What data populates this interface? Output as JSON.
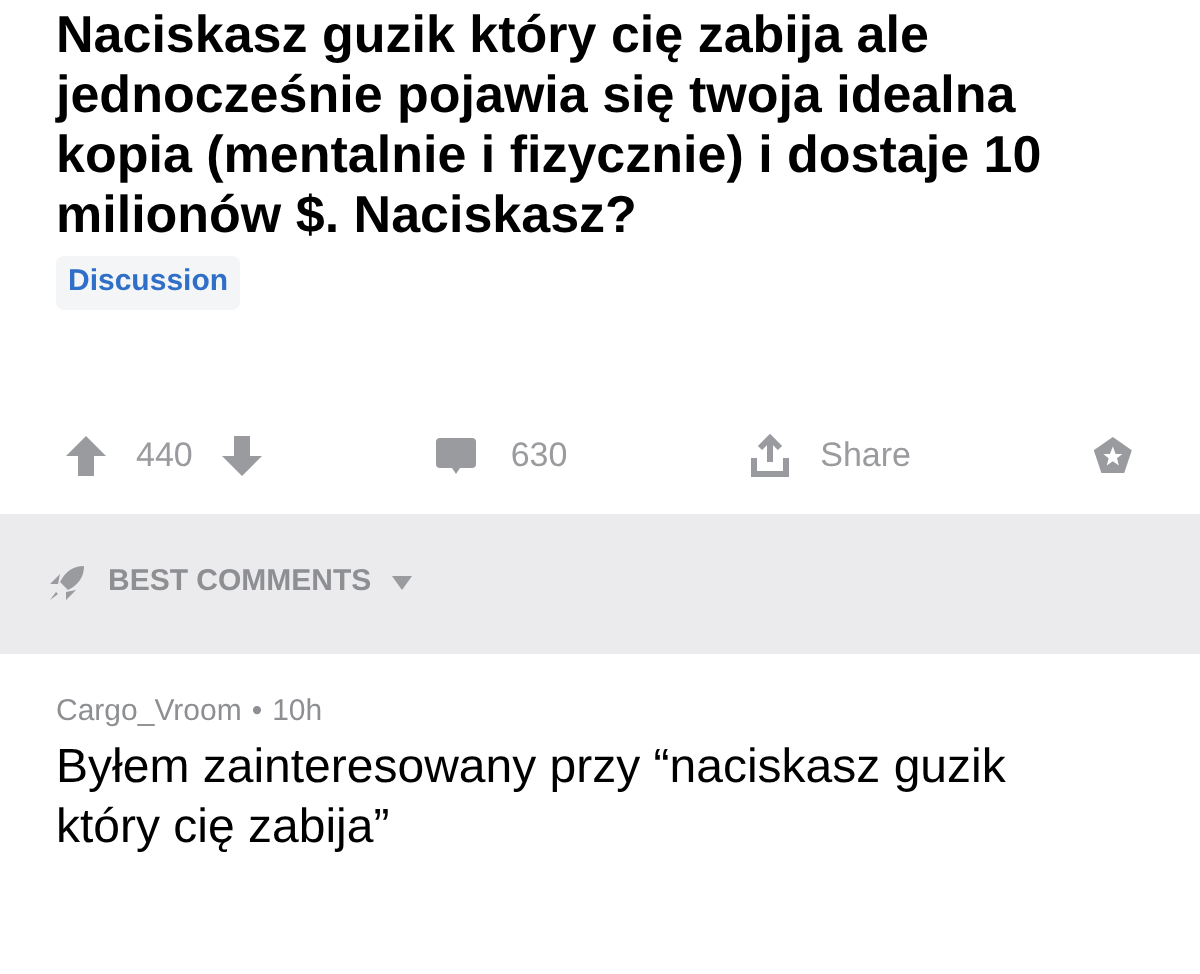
{
  "post": {
    "title": "Naciskasz guzik który cię zabija ale jednocześnie pojawia się twoja idealna kopia (mentalnie i fizycznie) i dostaje 10 milionów $. Naciskasz?",
    "flair": "Discussion"
  },
  "actions": {
    "score": "440",
    "comments": "630",
    "share": "Share"
  },
  "sort": {
    "label": "BEST COMMENTS"
  },
  "comments": [
    {
      "author": "Cargo_Vroom",
      "separator": "•",
      "time": "10h",
      "body": "Byłem zainteresowany przy “naciskasz guzik który cię zabija”"
    }
  ]
}
